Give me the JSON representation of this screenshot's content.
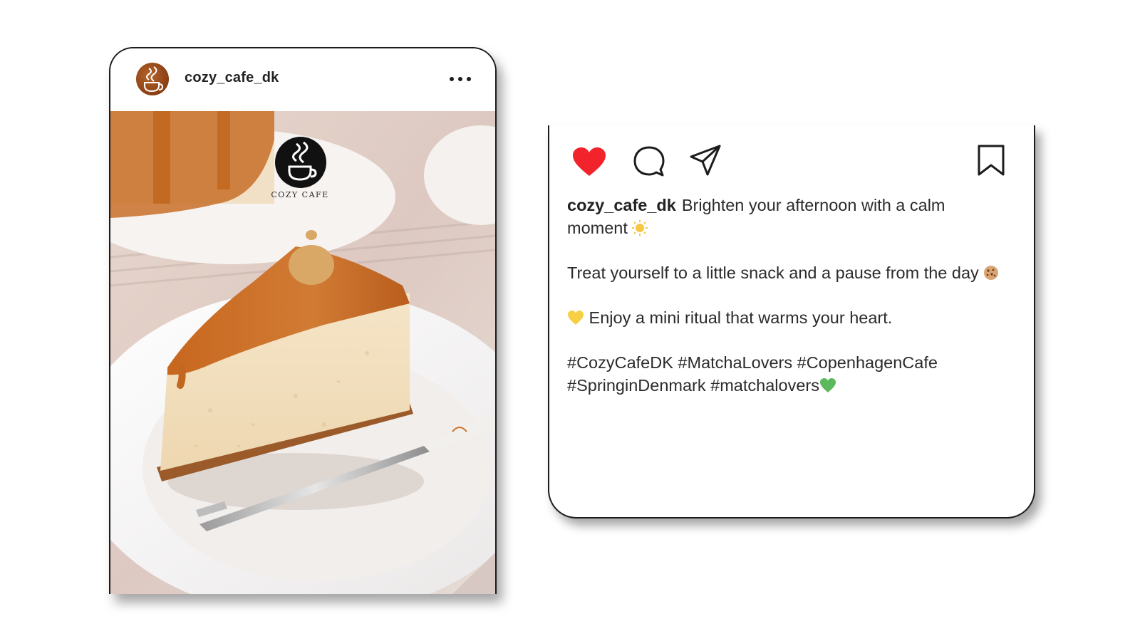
{
  "post": {
    "username": "cozy_cafe_dk",
    "brand_logo_text": "COZY CAFE"
  },
  "caption": {
    "username": "cozy_cafe_dk",
    "line1": "Brighten your afternoon with a calm moment",
    "line2": "Treat yourself to a little snack and a pause from the day",
    "line3": "Enjoy a mini ritual that warms your heart.",
    "hashtags": "#CozyCafeDK #MatchaLovers #CopenhagenCafe #SpringinDenmark #matchalovers"
  },
  "icons": {
    "more": "more-options-icon",
    "like": "heart-icon",
    "comment": "comment-icon",
    "share": "share-icon",
    "save": "bookmark-icon"
  },
  "colors": {
    "like_red": "#f2232b",
    "card_border": "#1c1c1c",
    "caramel": "#c9742a"
  }
}
